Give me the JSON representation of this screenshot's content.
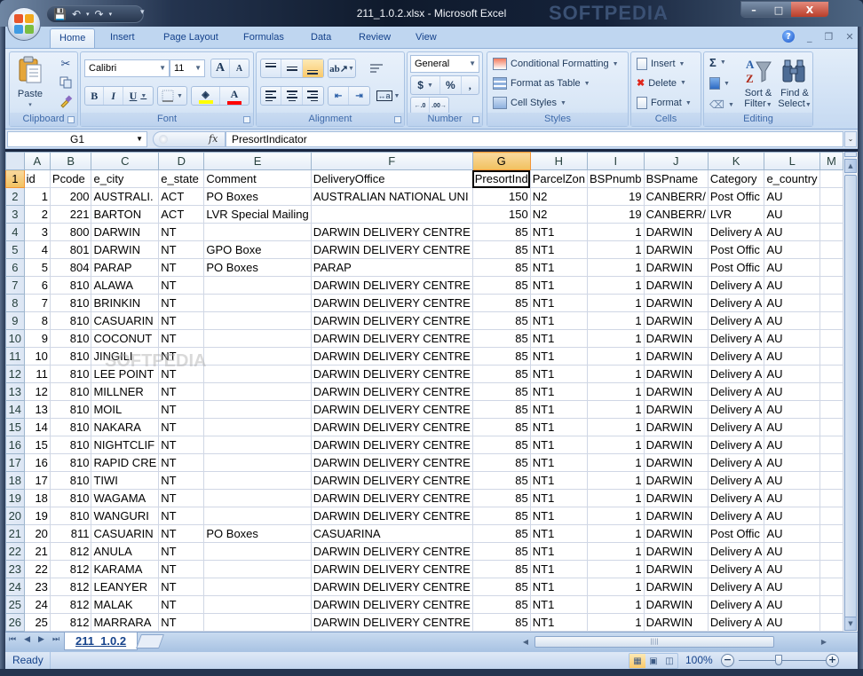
{
  "window": {
    "title": "211_1.0.2.xlsx - Microsoft Excel",
    "watermark": "SOFTPEDIA",
    "controls": {
      "minimize": "–",
      "maximize": "□",
      "close": "X"
    }
  },
  "quick_access": {
    "save_icon": "💾",
    "undo_icon": "↶",
    "redo_icon": "↷",
    "dropdown": "▾",
    "customize": "▾"
  },
  "ribbon_tabs": [
    {
      "label": "Home",
      "active": true
    },
    {
      "label": "Insert"
    },
    {
      "label": "Page Layout"
    },
    {
      "label": "Formulas"
    },
    {
      "label": "Data"
    },
    {
      "label": "Review"
    },
    {
      "label": "View"
    }
  ],
  "mdi_controls": {
    "help": "?",
    "minimize": "_",
    "restore": "❐",
    "close": "✕"
  },
  "ribbon": {
    "clipboard": {
      "label": "Clipboard",
      "paste": "Paste",
      "paste_arrow": "▾"
    },
    "font": {
      "label": "Font",
      "name": "Calibri",
      "size": "11",
      "grow": "A",
      "shrink": "A",
      "bold": "B",
      "italic": "I",
      "underline": "U",
      "fill_color": "#ffff00",
      "font_color": "#ff0000"
    },
    "alignment": {
      "label": "Alignment"
    },
    "number": {
      "label": "Number",
      "format": "General",
      "currency": "$",
      "percent": "%",
      "comma": ",",
      "inc_decimal": "←.0 .00",
      "dec_decimal": ".00 →.0"
    },
    "styles": {
      "label": "Styles",
      "conditional": "Conditional Formatting",
      "format_table": "Format as Table",
      "cell_styles": "Cell Styles"
    },
    "cells": {
      "label": "Cells",
      "insert": "Insert",
      "delete": "Delete",
      "format": "Format"
    },
    "editing": {
      "label": "Editing",
      "sum": "Σ",
      "sort_filter_1": "Sort &",
      "sort_filter_2": "Filter",
      "find_select_1": "Find &",
      "find_select_2": "Select"
    }
  },
  "formula_bar": {
    "name_box": "G1",
    "fx": "fx",
    "value": "PresortIndicator"
  },
  "columns": [
    "A",
    "B",
    "C",
    "D",
    "E",
    "F",
    "G",
    "H",
    "I",
    "J",
    "K",
    "L",
    "M"
  ],
  "selected_column": "G",
  "selected_row": 1,
  "header_row": [
    "id",
    "Pcode",
    "e_city",
    "e_state",
    "Comment",
    "DeliveryOffice",
    "PresortInd",
    "ParcelZon",
    "BSPnumb",
    "BSPname",
    "Category",
    "e_country",
    ""
  ],
  "rows": [
    [
      "1",
      "200",
      "AUSTRALI.",
      "ACT",
      "PO Boxes",
      "AUSTRALIAN NATIONAL UNI",
      "150",
      "N2",
      "19",
      "CANBERR/",
      "Post Offic",
      "AU",
      ""
    ],
    [
      "2",
      "221",
      "BARTON",
      "ACT",
      "LVR Special Mailing",
      "",
      "150",
      "N2",
      "19",
      "CANBERR/",
      "LVR",
      "AU",
      ""
    ],
    [
      "3",
      "800",
      "DARWIN",
      "NT",
      "",
      "DARWIN DELIVERY CENTRE",
      "85",
      "NT1",
      "1",
      "DARWIN",
      "Delivery A",
      "AU",
      ""
    ],
    [
      "4",
      "801",
      "DARWIN",
      "NT",
      "GPO Boxe",
      "DARWIN DELIVERY CENTRE",
      "85",
      "NT1",
      "1",
      "DARWIN",
      "Post Offic",
      "AU",
      ""
    ],
    [
      "5",
      "804",
      "PARAP",
      "NT",
      "PO Boxes",
      "PARAP",
      "85",
      "NT1",
      "1",
      "DARWIN",
      "Post Offic",
      "AU",
      ""
    ],
    [
      "6",
      "810",
      "ALAWA",
      "NT",
      "",
      "DARWIN DELIVERY CENTRE",
      "85",
      "NT1",
      "1",
      "DARWIN",
      "Delivery A",
      "AU",
      ""
    ],
    [
      "7",
      "810",
      "BRINKIN",
      "NT",
      "",
      "DARWIN DELIVERY CENTRE",
      "85",
      "NT1",
      "1",
      "DARWIN",
      "Delivery A",
      "AU",
      ""
    ],
    [
      "8",
      "810",
      "CASUARIN",
      "NT",
      "",
      "DARWIN DELIVERY CENTRE",
      "85",
      "NT1",
      "1",
      "DARWIN",
      "Delivery A",
      "AU",
      ""
    ],
    [
      "9",
      "810",
      "COCONUT",
      "NT",
      "",
      "DARWIN DELIVERY CENTRE",
      "85",
      "NT1",
      "1",
      "DARWIN",
      "Delivery A",
      "AU",
      ""
    ],
    [
      "10",
      "810",
      "JINGILI",
      "NT",
      "",
      "DARWIN DELIVERY CENTRE",
      "85",
      "NT1",
      "1",
      "DARWIN",
      "Delivery A",
      "AU",
      ""
    ],
    [
      "11",
      "810",
      "LEE POINT",
      "NT",
      "",
      "DARWIN DELIVERY CENTRE",
      "85",
      "NT1",
      "1",
      "DARWIN",
      "Delivery A",
      "AU",
      ""
    ],
    [
      "12",
      "810",
      "MILLNER",
      "NT",
      "",
      "DARWIN DELIVERY CENTRE",
      "85",
      "NT1",
      "1",
      "DARWIN",
      "Delivery A",
      "AU",
      ""
    ],
    [
      "13",
      "810",
      "MOIL",
      "NT",
      "",
      "DARWIN DELIVERY CENTRE",
      "85",
      "NT1",
      "1",
      "DARWIN",
      "Delivery A",
      "AU",
      ""
    ],
    [
      "14",
      "810",
      "NAKARA",
      "NT",
      "",
      "DARWIN DELIVERY CENTRE",
      "85",
      "NT1",
      "1",
      "DARWIN",
      "Delivery A",
      "AU",
      ""
    ],
    [
      "15",
      "810",
      "NIGHTCLIF",
      "NT",
      "",
      "DARWIN DELIVERY CENTRE",
      "85",
      "NT1",
      "1",
      "DARWIN",
      "Delivery A",
      "AU",
      ""
    ],
    [
      "16",
      "810",
      "RAPID CRE",
      "NT",
      "",
      "DARWIN DELIVERY CENTRE",
      "85",
      "NT1",
      "1",
      "DARWIN",
      "Delivery A",
      "AU",
      ""
    ],
    [
      "17",
      "810",
      "TIWI",
      "NT",
      "",
      "DARWIN DELIVERY CENTRE",
      "85",
      "NT1",
      "1",
      "DARWIN",
      "Delivery A",
      "AU",
      ""
    ],
    [
      "18",
      "810",
      "WAGAMA",
      "NT",
      "",
      "DARWIN DELIVERY CENTRE",
      "85",
      "NT1",
      "1",
      "DARWIN",
      "Delivery A",
      "AU",
      ""
    ],
    [
      "19",
      "810",
      "WANGURI",
      "NT",
      "",
      "DARWIN DELIVERY CENTRE",
      "85",
      "NT1",
      "1",
      "DARWIN",
      "Delivery A",
      "AU",
      ""
    ],
    [
      "20",
      "811",
      "CASUARIN",
      "NT",
      "PO Boxes",
      "CASUARINA",
      "85",
      "NT1",
      "1",
      "DARWIN",
      "Post Offic",
      "AU",
      ""
    ],
    [
      "21",
      "812",
      "ANULA",
      "NT",
      "",
      "DARWIN DELIVERY CENTRE",
      "85",
      "NT1",
      "1",
      "DARWIN",
      "Delivery A",
      "AU",
      ""
    ],
    [
      "22",
      "812",
      "KARAMA",
      "NT",
      "",
      "DARWIN DELIVERY CENTRE",
      "85",
      "NT1",
      "1",
      "DARWIN",
      "Delivery A",
      "AU",
      ""
    ],
    [
      "23",
      "812",
      "LEANYER",
      "NT",
      "",
      "DARWIN DELIVERY CENTRE",
      "85",
      "NT1",
      "1",
      "DARWIN",
      "Delivery A",
      "AU",
      ""
    ],
    [
      "24",
      "812",
      "MALAK",
      "NT",
      "",
      "DARWIN DELIVERY CENTRE",
      "85",
      "NT1",
      "1",
      "DARWIN",
      "Delivery A",
      "AU",
      ""
    ],
    [
      "25",
      "812",
      "MARRARA",
      "NT",
      "",
      "DARWIN DELIVERY CENTRE",
      "85",
      "NT1",
      "1",
      "DARWIN",
      "Delivery A",
      "AU",
      ""
    ]
  ],
  "numeric_columns": [
    0,
    1,
    6,
    8
  ],
  "sheet_tabs": [
    {
      "label": "211_1.0.2",
      "active": true
    }
  ],
  "sheet_nav": [
    "⏮",
    "◀",
    "▶",
    "⏭"
  ],
  "status": {
    "ready": "Ready",
    "zoom": "100%",
    "zoom_out": "−",
    "zoom_in": "+"
  }
}
